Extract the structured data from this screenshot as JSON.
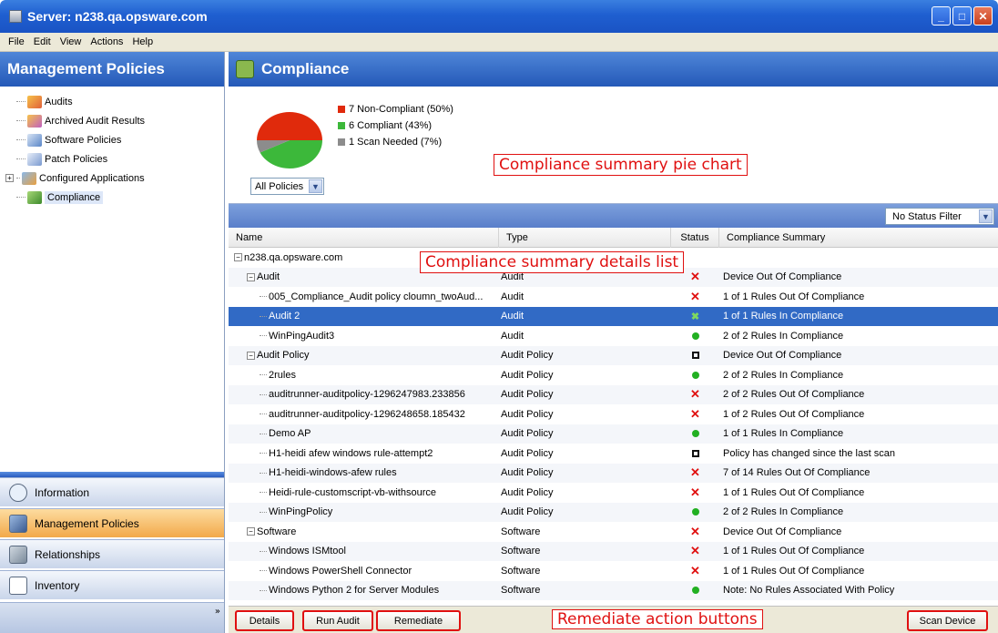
{
  "window": {
    "title": "Server: n238.qa.opsware.com"
  },
  "menu": [
    "File",
    "Edit",
    "View",
    "Actions",
    "Help"
  ],
  "left_panel": {
    "title": "Management Policies",
    "tree": [
      {
        "label": "Audits",
        "icon": "audit-icon"
      },
      {
        "label": "Archived Audit Results",
        "icon": "archived-audit-icon"
      },
      {
        "label": "Software Policies",
        "icon": "software-policy-icon"
      },
      {
        "label": "Patch Policies",
        "icon": "patch-policy-icon"
      },
      {
        "label": "Configured Applications",
        "icon": "configured-apps-icon"
      },
      {
        "label": "Compliance",
        "icon": "compliance-icon"
      }
    ],
    "nav": [
      {
        "label": "Information",
        "icon": "information-icon"
      },
      {
        "label": "Management Policies",
        "icon": "management-policies-icon"
      },
      {
        "label": "Relationships",
        "icon": "relationships-icon"
      },
      {
        "label": "Inventory",
        "icon": "inventory-icon"
      }
    ]
  },
  "compliance": {
    "title": "Compliance",
    "legend": [
      {
        "label": "7 Non-Compliant (50%)",
        "color": "#e02a0c"
      },
      {
        "label": "6 Compliant (43%)",
        "color": "#3cb83a"
      },
      {
        "label": "1 Scan Needed (7%)",
        "color": "#8c8c8c"
      }
    ],
    "policy_filter": "All Policies",
    "status_filter": "No Status Filter",
    "annotations": {
      "pie": "Compliance summary pie chart",
      "list": "Compliance summary details list",
      "buttons": "Remediate action buttons"
    },
    "columns": [
      "Name",
      "Type",
      "Status",
      "Compliance Summary"
    ],
    "rows": [
      {
        "name": "n238.qa.opsware.com",
        "type": "",
        "status": "",
        "summary": ""
      },
      {
        "name": "Audit",
        "type": "Audit",
        "status": "x",
        "summary": "Device Out Of Compliance"
      },
      {
        "name": "005_Compliance_Audit policy cloumn_twoAud...",
        "type": "Audit",
        "status": "x",
        "summary": "1 of 1 Rules Out Of Compliance"
      },
      {
        "name": "Audit 2",
        "type": "Audit",
        "status": "ok",
        "summary": "1 of 1 Rules In Compliance"
      },
      {
        "name": "WinPingAudit3",
        "type": "Audit",
        "status": "dot",
        "summary": "2 of 2 Rules In Compliance"
      },
      {
        "name": "Audit Policy",
        "type": "Audit Policy",
        "status": "box",
        "summary": "Device Out Of Compliance"
      },
      {
        "name": "2rules",
        "type": "Audit Policy",
        "status": "dot",
        "summary": "2 of 2 Rules In Compliance"
      },
      {
        "name": "auditrunner-auditpolicy-1296247983.233856",
        "type": "Audit Policy",
        "status": "x",
        "summary": "2 of 2 Rules Out Of Compliance"
      },
      {
        "name": "auditrunner-auditpolicy-1296248658.185432",
        "type": "Audit Policy",
        "status": "x",
        "summary": "1 of 2 Rules Out Of Compliance"
      },
      {
        "name": "Demo AP",
        "type": "Audit Policy",
        "status": "dot",
        "summary": "1 of 1 Rules In Compliance"
      },
      {
        "name": "H1-heidi afew windows rule-attempt2",
        "type": "Audit Policy",
        "status": "box",
        "summary": "Policy has changed since the last scan"
      },
      {
        "name": "H1-heidi-windows-afew rules",
        "type": "Audit Policy",
        "status": "x",
        "summary": "7 of 14 Rules Out Of Compliance"
      },
      {
        "name": "Heidi-rule-customscript-vb-withsource",
        "type": "Audit Policy",
        "status": "x",
        "summary": "1 of 1 Rules Out Of Compliance"
      },
      {
        "name": "WinPingPolicy",
        "type": "Audit Policy",
        "status": "dot",
        "summary": "2 of 2 Rules In Compliance"
      },
      {
        "name": "Software",
        "type": "Software",
        "status": "x",
        "summary": "Device Out Of Compliance"
      },
      {
        "name": "Windows ISMtool",
        "type": "Software",
        "status": "x",
        "summary": "1 of 1 Rules Out Of Compliance"
      },
      {
        "name": "Windows PowerShell Connector",
        "type": "Software",
        "status": "x",
        "summary": "1 of 1 Rules Out Of Compliance"
      },
      {
        "name": "Windows Python 2 for Server Modules",
        "type": "Software",
        "status": "dot",
        "summary": "Note: No Rules Associated With Policy"
      }
    ],
    "buttons": {
      "details": "Details",
      "run_audit": "Run Audit",
      "remediate": "Remediate",
      "scan_device": "Scan Device"
    }
  },
  "chart_data": {
    "type": "pie",
    "categories": [
      "Non-Compliant",
      "Compliant",
      "Scan Needed"
    ],
    "values": [
      7,
      6,
      1
    ],
    "colors": [
      "#e02a0c",
      "#3cb83a",
      "#8c8c8c"
    ]
  }
}
